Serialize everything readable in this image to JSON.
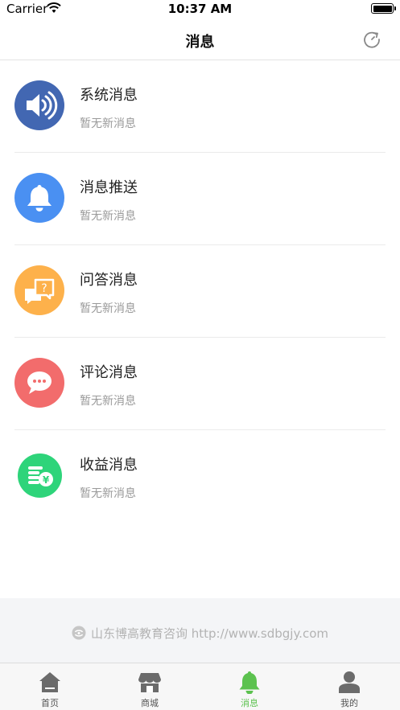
{
  "status_bar": {
    "carrier": "Carrier",
    "time": "10:37 AM"
  },
  "header": {
    "title": "消息",
    "refresh_icon": "refresh-icon"
  },
  "messages": [
    {
      "title": "系统消息",
      "subtitle": "暂无新消息",
      "icon": "speaker-icon",
      "color": "#4267b2"
    },
    {
      "title": "消息推送",
      "subtitle": "暂无新消息",
      "icon": "bell-icon",
      "color": "#4a90f2"
    },
    {
      "title": "问答消息",
      "subtitle": "暂无新消息",
      "icon": "question-icon",
      "color": "#fdb14b"
    },
    {
      "title": "评论消息",
      "subtitle": "暂无新消息",
      "icon": "comment-icon",
      "color": "#f26c6c"
    },
    {
      "title": "收益消息",
      "subtitle": "暂无新消息",
      "icon": "coins-yen-icon",
      "color": "#2ed47a"
    }
  ],
  "footer": {
    "text": "山东博高教育咨询  http://www.sdbgjy.com"
  },
  "tabs": [
    {
      "label": "首页",
      "icon": "home-icon",
      "active": false
    },
    {
      "label": "商城",
      "icon": "store-icon",
      "active": false
    },
    {
      "label": "消息",
      "icon": "bell-icon",
      "active": true
    },
    {
      "label": "我的",
      "icon": "user-icon",
      "active": false
    }
  ],
  "colors": {
    "active_tab": "#5cc24f",
    "inactive_tab": "#555555"
  }
}
